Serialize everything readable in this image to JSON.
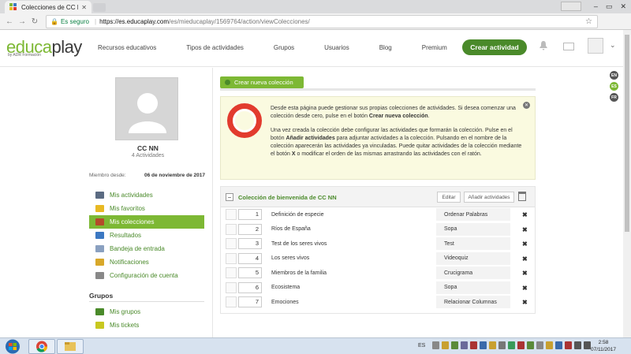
{
  "browser": {
    "tab_title": "Colecciones de CC NN -",
    "secure_label": "Es seguro",
    "url_host": "https://es.educaplay.com",
    "url_path": "/es/mieducaplay/1569764/action/viewColecciones/",
    "ext_label": "w³"
  },
  "site": {
    "logo_edu": "educa",
    "logo_play": "play",
    "logo_sub": "by ADR Formación",
    "nav": [
      "Recursos educativos",
      "Tipos de actividades",
      "Grupos",
      "Usuarios",
      "Blog",
      "Premium"
    ],
    "create_label": "Crear actividad",
    "languages": [
      "EN",
      "ES",
      "FR"
    ]
  },
  "profile": {
    "name": "CC NN",
    "activities": "4 Actividades",
    "member_label": "Miembro desde:",
    "member_date": "06 de noviembre de 2017"
  },
  "menu": [
    {
      "label": "Mis actividades",
      "color": "#5b6b82"
    },
    {
      "label": "Mis favoritos",
      "color": "#e8b923"
    },
    {
      "label": "Mis colecciones",
      "color": "#b44a2a"
    },
    {
      "label": "Resultados",
      "color": "#3b78c2"
    },
    {
      "label": "Bandeja de entrada",
      "color": "#8aa0c0"
    },
    {
      "label": "Notificaciones",
      "color": "#d8a82a"
    },
    {
      "label": "Configuración de cuenta",
      "color": "#888888"
    }
  ],
  "groups": {
    "heading": "Grupos",
    "items": [
      {
        "label": "Mis grupos",
        "color": "#4a8a2a"
      },
      {
        "label": "Mis tickets",
        "color": "#c8c820"
      }
    ]
  },
  "main": {
    "new_collection_label": "Crear nueva colección",
    "info_p1_a": "Desde esta página puede gestionar sus propias colecciones de actividades. Si desea comenzar una colección desde cero, pulse en el botón ",
    "info_p1_b": "Crear nueva colección",
    "info_p1_c": ".",
    "info_p2_a": "Una vez creada la colección debe configurar las actividades que formarán la colección. Pulse en el botón ",
    "info_p2_b": "Añadir actividades",
    "info_p2_c": " para adjuntar actividades a la colección. Pulsando en el nombre de la colección aparecerán las actividades ya vinculadas. Puede quitar actividades de la colección mediante el botón ",
    "info_p2_d": "X",
    "info_p2_e": " o modificar el orden de las mismas arrastrando las actividades con el ratón.",
    "collection": {
      "title": "Colección de bienvenida de CC NN",
      "edit_label": "Editar",
      "add_label": "Añadir actividades",
      "rows": [
        {
          "num": "1",
          "name": "Definición de especie",
          "type": "Ordenar Palabras"
        },
        {
          "num": "2",
          "name": "Ríos de España",
          "type": "Sopa"
        },
        {
          "num": "3",
          "name": "Test de los seres vivos",
          "type": "Test"
        },
        {
          "num": "4",
          "name": "Los seres vivos",
          "type": "Videoquiz"
        },
        {
          "num": "5",
          "name": "Miembros de la familia",
          "type": "Crucigrama"
        },
        {
          "num": "6",
          "name": "Ecosistema",
          "type": "Sopa"
        },
        {
          "num": "7",
          "name": "Emociones",
          "type": "Relacionar Columnas"
        }
      ]
    }
  },
  "taskbar": {
    "lang": "ES",
    "time": "2:58",
    "date": "07/11/2017"
  }
}
